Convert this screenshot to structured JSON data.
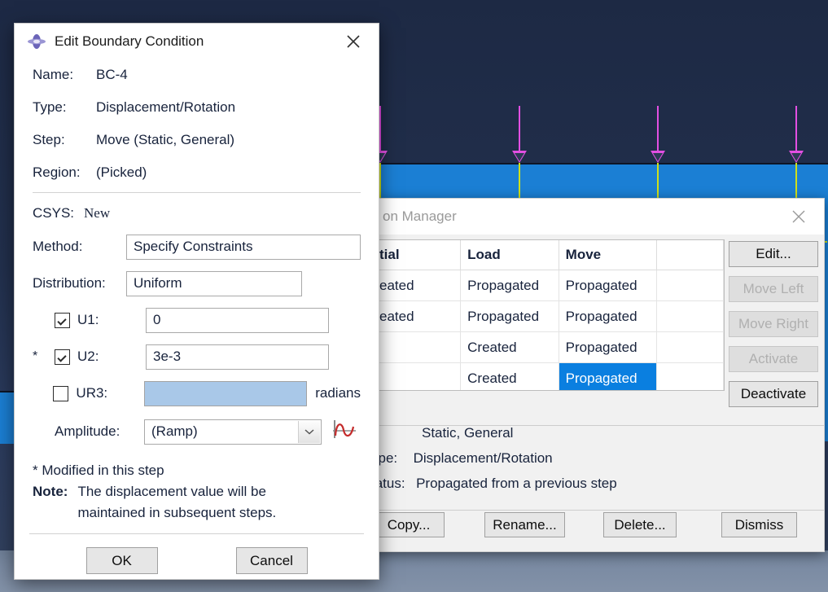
{
  "viewport": {
    "name": "abaqus-3d-viewport",
    "background_color": "#22304d",
    "part_color": "#1b7fd4",
    "arrow_color": "#e24fe2",
    "constraint_color": "#cfe01a",
    "bottom_band_color": "#7b8ba3"
  },
  "edit_dialog": {
    "title": "Edit Boundary Condition",
    "icon": "bc-spinner-icon",
    "close_label": "✕",
    "fields": {
      "name_label": "Name:",
      "name_value": "BC-4",
      "type_label": "Type:",
      "type_value": "Displacement/Rotation",
      "step_label": "Step:",
      "step_value": "Move (Static, General)",
      "region_label": "Region:",
      "region_value": "(Picked)",
      "csys_label": "CSYS:",
      "csys_value": "New",
      "method_label": "Method:",
      "method_value": "Specify Constraints",
      "distribution_label": "Distribution:",
      "distribution_value": "Uniform",
      "u1_label": "U1:",
      "u1_value": "0",
      "u1_checked": true,
      "u1_modified": false,
      "u2_label": "U2:",
      "u2_value": "3e-3",
      "u2_checked": true,
      "u2_modified": true,
      "u2_modified_marker": "*",
      "ur3_label": "UR3:",
      "ur3_value": "",
      "ur3_checked": false,
      "ur3_units": "radians",
      "amplitude_label": "Amplitude:",
      "amplitude_value": "(Ramp)",
      "amplitude_icon": "amplitude-waveform-icon"
    },
    "footnote": "* Modified in this step",
    "note_label": "Note:",
    "note_line1": "The displacement value will be",
    "note_line2": "maintained in subsequent steps.",
    "ok_label": "OK",
    "cancel_label": "Cancel"
  },
  "manager_dialog": {
    "title": "on Manager",
    "close_label": "✕",
    "table": {
      "headers": [
        "tial",
        "Load",
        "Move",
        ""
      ],
      "rows": [
        [
          "eated",
          "Propagated",
          "Propagated",
          ""
        ],
        [
          "eated",
          "Propagated",
          "Propagated",
          ""
        ],
        [
          "",
          "Created",
          "Propagated",
          ""
        ],
        [
          "",
          "Created",
          "Propagated",
          ""
        ]
      ],
      "selected_row": 3,
      "selected_col": 2,
      "selection_color": "#0a7fe0"
    },
    "side_buttons": [
      {
        "label": "Edit...",
        "enabled": true
      },
      {
        "label": "Move Left",
        "enabled": false
      },
      {
        "label": "Move Right",
        "enabled": false
      },
      {
        "label": "Activate",
        "enabled": false
      },
      {
        "label": "Deactivate",
        "enabled": true
      }
    ],
    "info": {
      "line1_label": "",
      "line1_value": "Static, General",
      "line2_label": "ype:",
      "line2_value": "Displacement/Rotation",
      "line3_label": "tatus:",
      "line3_value": "Propagated from a previous step"
    },
    "bottom_buttons": [
      {
        "label": "Copy..."
      },
      {
        "label": "Rename..."
      },
      {
        "label": "Delete..."
      },
      {
        "label": "Dismiss"
      }
    ]
  }
}
